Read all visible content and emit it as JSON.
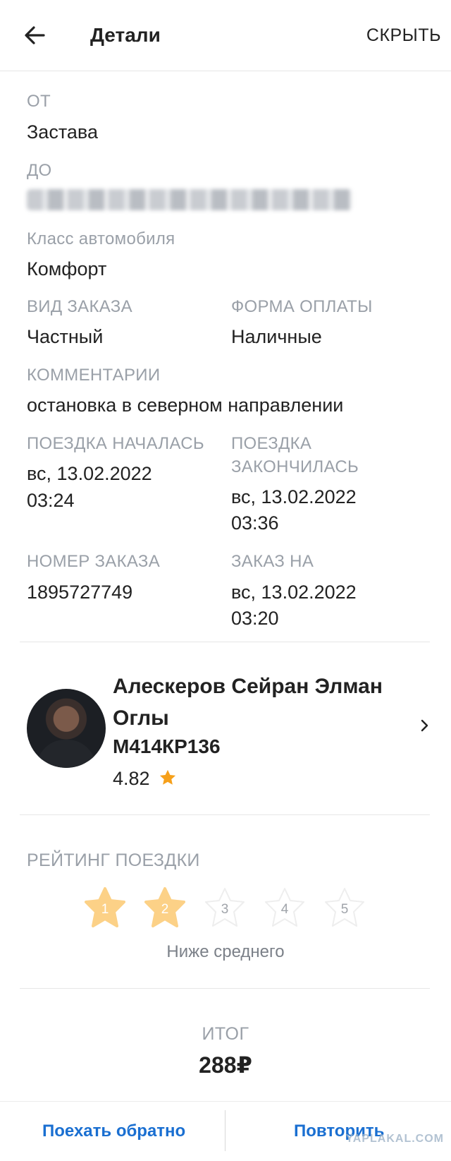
{
  "header": {
    "title": "Детали",
    "hide_label": "СКРЫТЬ"
  },
  "details": {
    "from_label": "ОТ",
    "from_value": "Застава",
    "to_label": "ДО",
    "car_class_label": "Класс автомобиля",
    "car_class_value": "Комфорт",
    "order_type_label": "ВИД ЗАКАЗА",
    "order_type_value": "Частный",
    "payment_label": "ФОРМА ОПЛАТЫ",
    "payment_value": "Наличные",
    "comments_label": "КОММЕНТАРИИ",
    "comments_value": "остановка в северном направлении",
    "trip_started_label": "ПОЕЗДКА НАЧАЛАСЬ",
    "trip_started_date": "вс, 13.02.2022",
    "trip_started_time": "03:24",
    "trip_ended_label_1": "ПОЕЗДКА",
    "trip_ended_label_2": "ЗАКОНЧИЛАСЬ",
    "trip_ended_date": "вс, 13.02.2022",
    "trip_ended_time": "03:36",
    "order_number_label": "НОМЕР ЗАКАЗА",
    "order_number_value": "1895727749",
    "order_for_label": "ЗАКАЗ НА",
    "order_for_date": "вс, 13.02.2022",
    "order_for_time": "03:20"
  },
  "driver": {
    "name": "Алескеров Сейран Элман Оглы",
    "plate": "М414КР136",
    "rating": "4.82",
    "rating_icon": "star-icon"
  },
  "trip_rating": {
    "label": "РЕЙТИНГ ПОЕЗДКИ",
    "value": 2,
    "max": 5,
    "star_labels": [
      "1",
      "2",
      "3",
      "4",
      "5"
    ],
    "caption": "Ниже среднего"
  },
  "total": {
    "label": "ИТОГ",
    "value": "288₽"
  },
  "footer": {
    "go_back_label": "Поехать обратно",
    "repeat_label": "Повторить",
    "watermark": "YAPLAKAL.COM"
  },
  "colors": {
    "accent": "#1a6fd1",
    "star_filled": "#fcd187",
    "star_empty": "#eeeeee",
    "driver_star": "#f6a01a"
  }
}
